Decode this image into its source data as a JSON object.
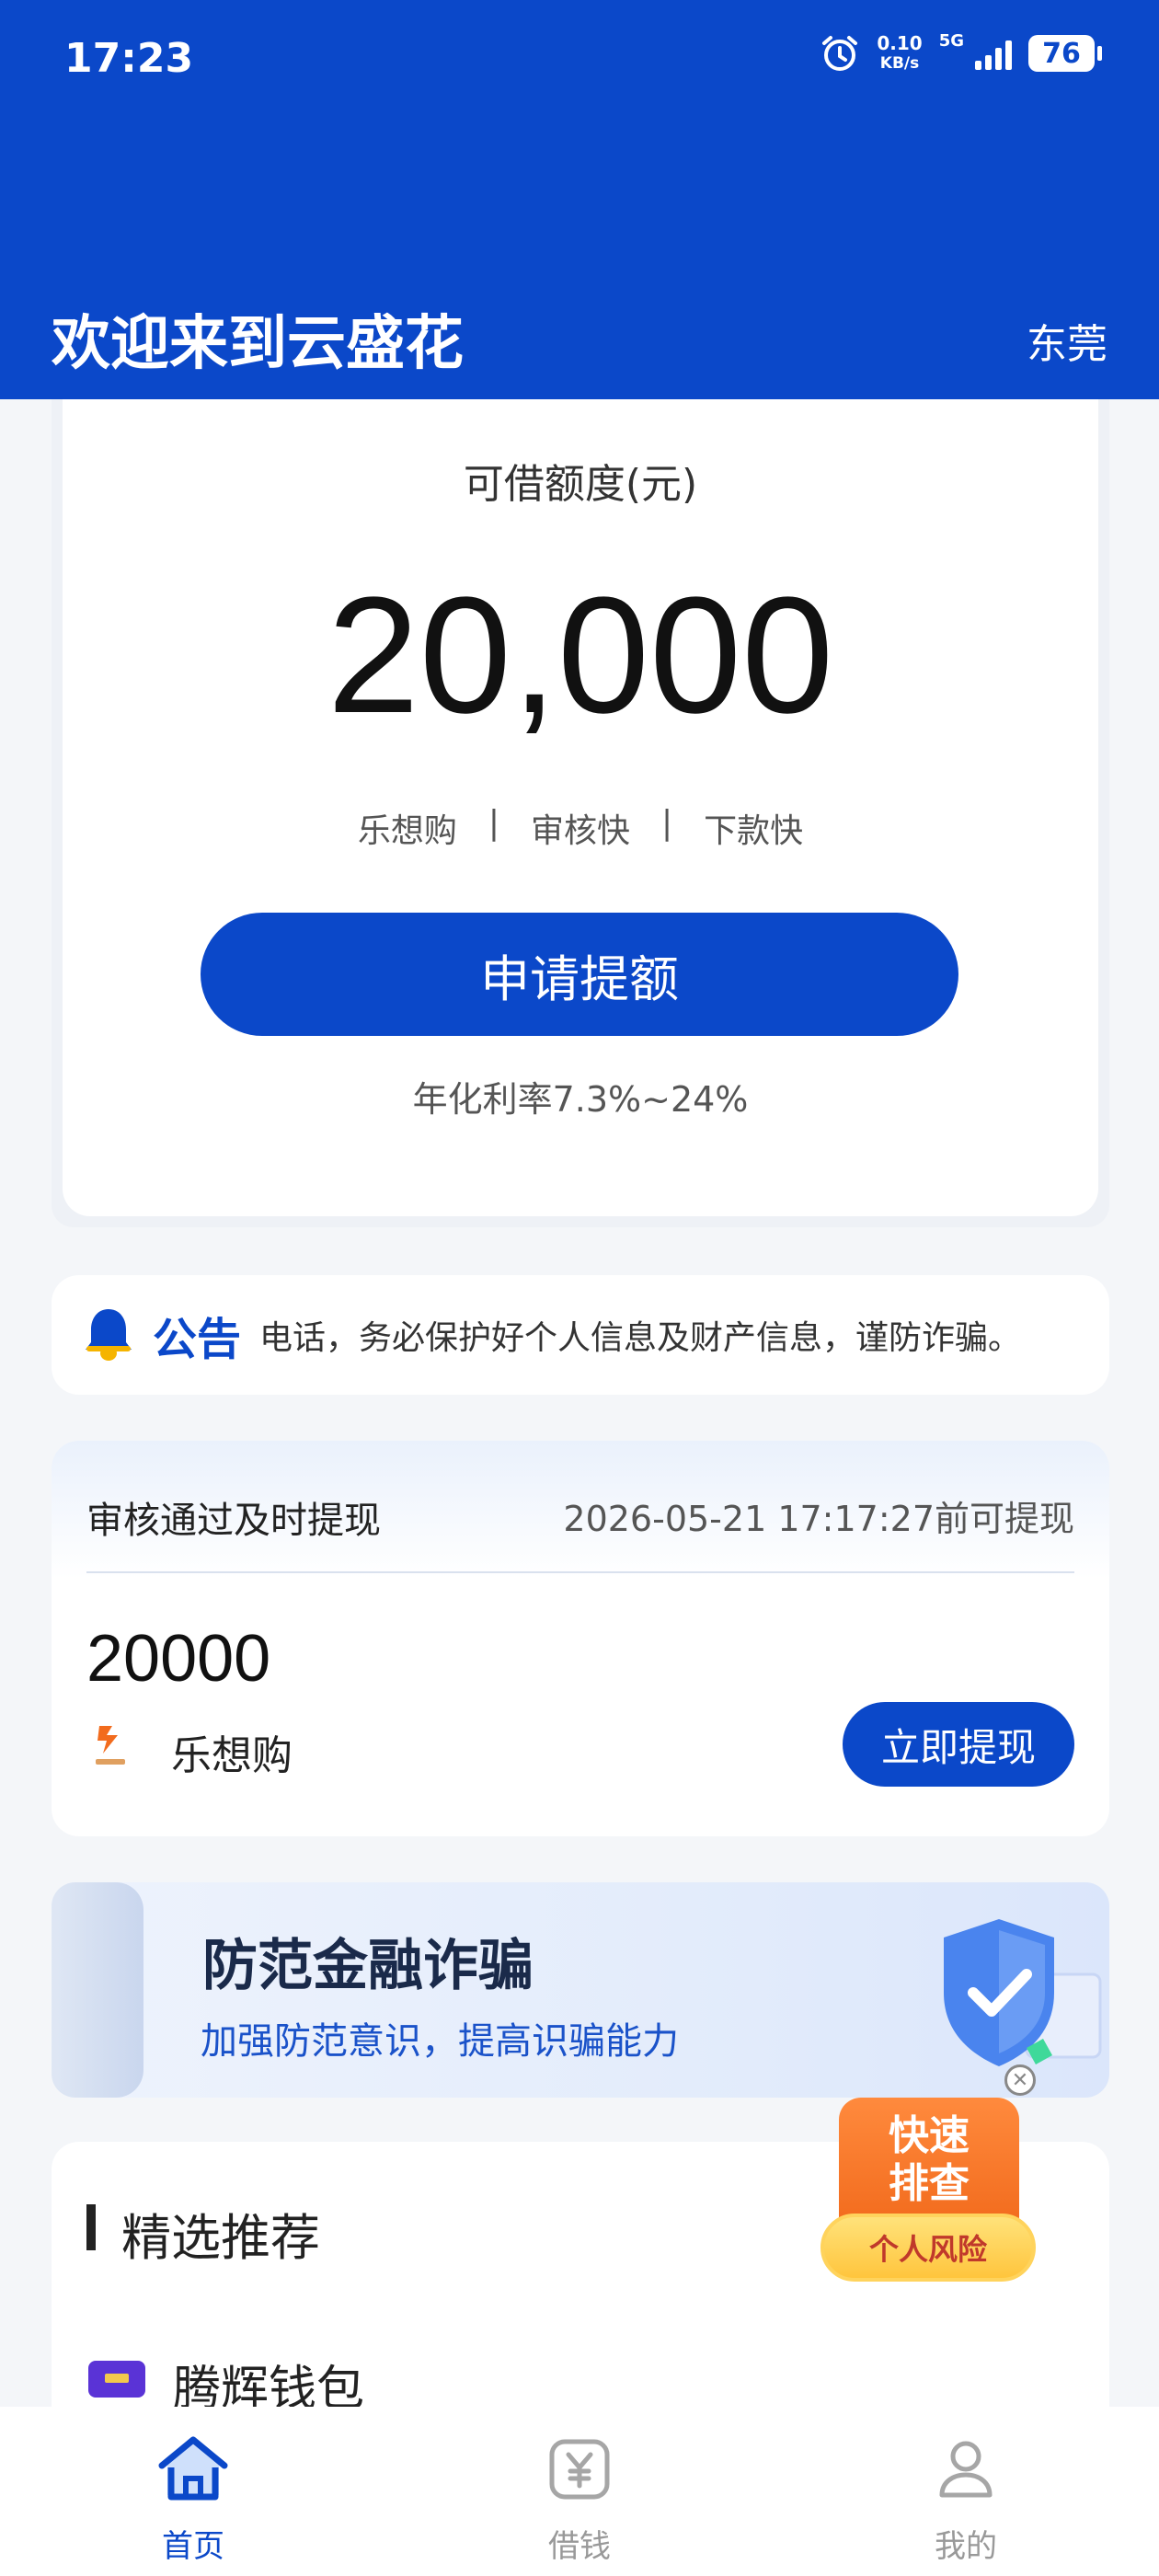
{
  "status_bar": {
    "time": "17:23",
    "net_speed_value": "0.10",
    "net_speed_unit": "KB/s",
    "network": "5G",
    "battery": "76"
  },
  "header": {
    "title": "欢迎来到云盛花",
    "city": "东莞"
  },
  "credit": {
    "label": "可借额度(元)",
    "amount": "20,000",
    "tags": [
      "乐想购",
      "审核快",
      "下款快"
    ],
    "tag_separator": "|",
    "apply_button": "申请提额",
    "rate": "年化利率7.3%~24%"
  },
  "notice": {
    "label": "公告",
    "text": "电话，务必保护好个人信息及财产信息，谨防诈骗。"
  },
  "withdraw": {
    "title": "审核通过及时提现",
    "deadline": "2026-05-21 17:17:27前可提现",
    "amount": "20000",
    "merchant_name": "乐想购",
    "button": "立即提现"
  },
  "banner": {
    "title": "防范金融诈骗",
    "subtitle": "加强防范意识，提高识骗能力"
  },
  "risk_float": {
    "line1": "快速",
    "line2": "排查",
    "badge": "个人风险"
  },
  "recommend": {
    "title": "精选推荐",
    "items": [
      {
        "name": "腾辉钱包"
      }
    ]
  },
  "bottom_nav": {
    "items": [
      {
        "label": "首页",
        "icon": "home-icon",
        "active": true
      },
      {
        "label": "借钱",
        "icon": "yen-icon",
        "active": false
      },
      {
        "label": "我的",
        "icon": "user-icon",
        "active": false
      }
    ]
  },
  "colors": {
    "brand": "#0b48c9",
    "background": "#f4f6f9",
    "risk_orange": "#f26b1d",
    "risk_yellow": "#ffc53d"
  }
}
